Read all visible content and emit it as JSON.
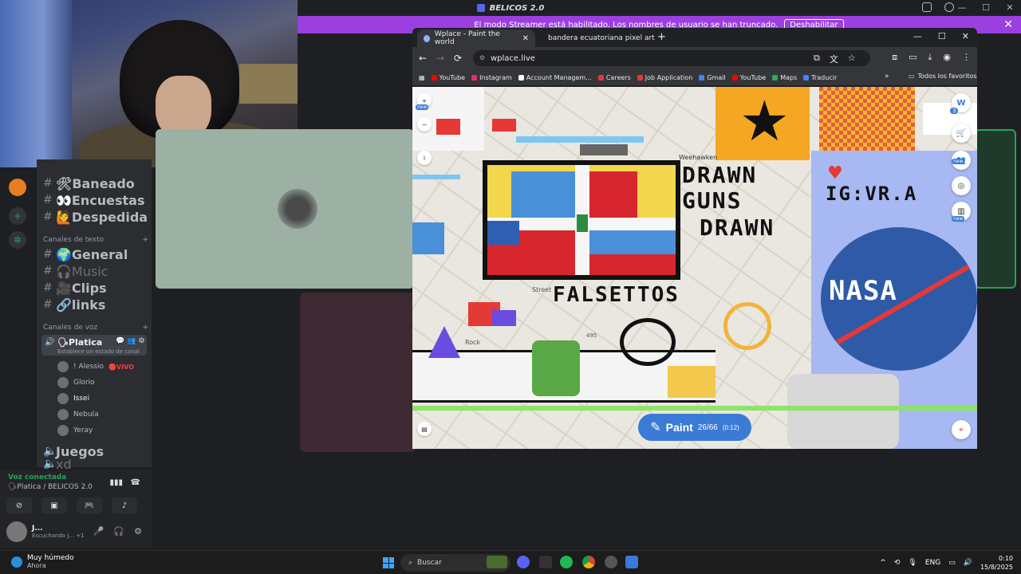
{
  "discord": {
    "app_title": "BELICOS 2.0",
    "streamer_banner": {
      "text": "El modo Streamer está habilitado. Los nombres de usuario se han truncado.",
      "button": "Deshabilitar"
    },
    "channels": [
      {
        "name": "🛠Baneado",
        "dim": false
      },
      {
        "name": "👀Encuestas",
        "dim": false
      },
      {
        "name": "🙋Despedida",
        "dim": false
      }
    ],
    "text_category": "Canales de texto",
    "text_channels": [
      {
        "name": "🌍General",
        "dim": false
      },
      {
        "name": "🎧Music",
        "dim": true
      },
      {
        "name": "🎥Clips",
        "dim": false
      },
      {
        "name": "🔗links",
        "dim": false
      }
    ],
    "voice_category": "Canales de voz",
    "active_voice": {
      "name": "🗣Platica",
      "status": "Establece un estado de canal"
    },
    "voice_users": [
      {
        "name": "! Alessio",
        "badge": "🔴VIVO"
      },
      {
        "name": "Glorio",
        "badge": ""
      },
      {
        "name": "Issei",
        "badge": ""
      },
      {
        "name": "Nebula",
        "badge": ""
      },
      {
        "name": "Yeray",
        "badge": ""
      }
    ],
    "voice_channel_2": "Juegos",
    "voice_channel_3": "xd",
    "connection": {
      "status": "Voz conectada",
      "channel": "🗣Platica / BELICOS 2.0"
    },
    "user": {
      "name": "J...",
      "activity": "Escuchando J...",
      "extra": "+1"
    }
  },
  "chrome": {
    "tabs": [
      {
        "title": "Wplace - Paint the world",
        "active": true
      },
      {
        "title": "bandera ecuatoriana pixel art - ",
        "active": false
      }
    ],
    "url": "wplace.live",
    "bookmarks": [
      {
        "label": "YouTube",
        "color": "#ff0000"
      },
      {
        "label": "Instagram",
        "color": "#e1306c"
      },
      {
        "label": "Account Managem...",
        "color": "#ffffff"
      },
      {
        "label": "Careers",
        "color": "#e53935"
      },
      {
        "label": "Job Application",
        "color": "#e53935"
      },
      {
        "label": "Gmail",
        "color": "#4285f4"
      },
      {
        "label": "YouTube",
        "color": "#ff0000"
      },
      {
        "label": "Maps",
        "color": "#34a853"
      },
      {
        "label": "Traducir",
        "color": "#4285f4"
      }
    ],
    "bookmarks_more": "»",
    "all_bookmarks": "Todos los favoritos"
  },
  "wplace": {
    "texts": {
      "drawn1": "DRAWN",
      "guns": "GUNS",
      "drawn2": "DRAWN",
      "falsettos": "FALSETTOS",
      "ig": "IG:VR.A",
      "nasa": "NASA"
    },
    "paint": {
      "label": "Paint",
      "count": "26/66",
      "timer": "(0:12)"
    },
    "badges": {
      "new1": "new",
      "new2": "new",
      "new3": "new",
      "count": "3"
    },
    "map_labels": {
      "street": "Street",
      "rock": "Rock",
      "route": "495",
      "weehawken": "Weehawken"
    },
    "colors": {
      "flag_blue": "#4a90d9",
      "flag_red": "#d7262e",
      "flag_white": "#f6f6f6",
      "flag_yellow": "#f2d64b",
      "nasa_blue": "#2e5aa8",
      "paint_button": "#3a7bd5"
    }
  },
  "taskbar": {
    "weather_title": "Muy húmedo",
    "weather_sub": "Ahora",
    "search": "Buscar",
    "lang": "ENG",
    "time": "0:10",
    "date": "15/8/2025"
  }
}
